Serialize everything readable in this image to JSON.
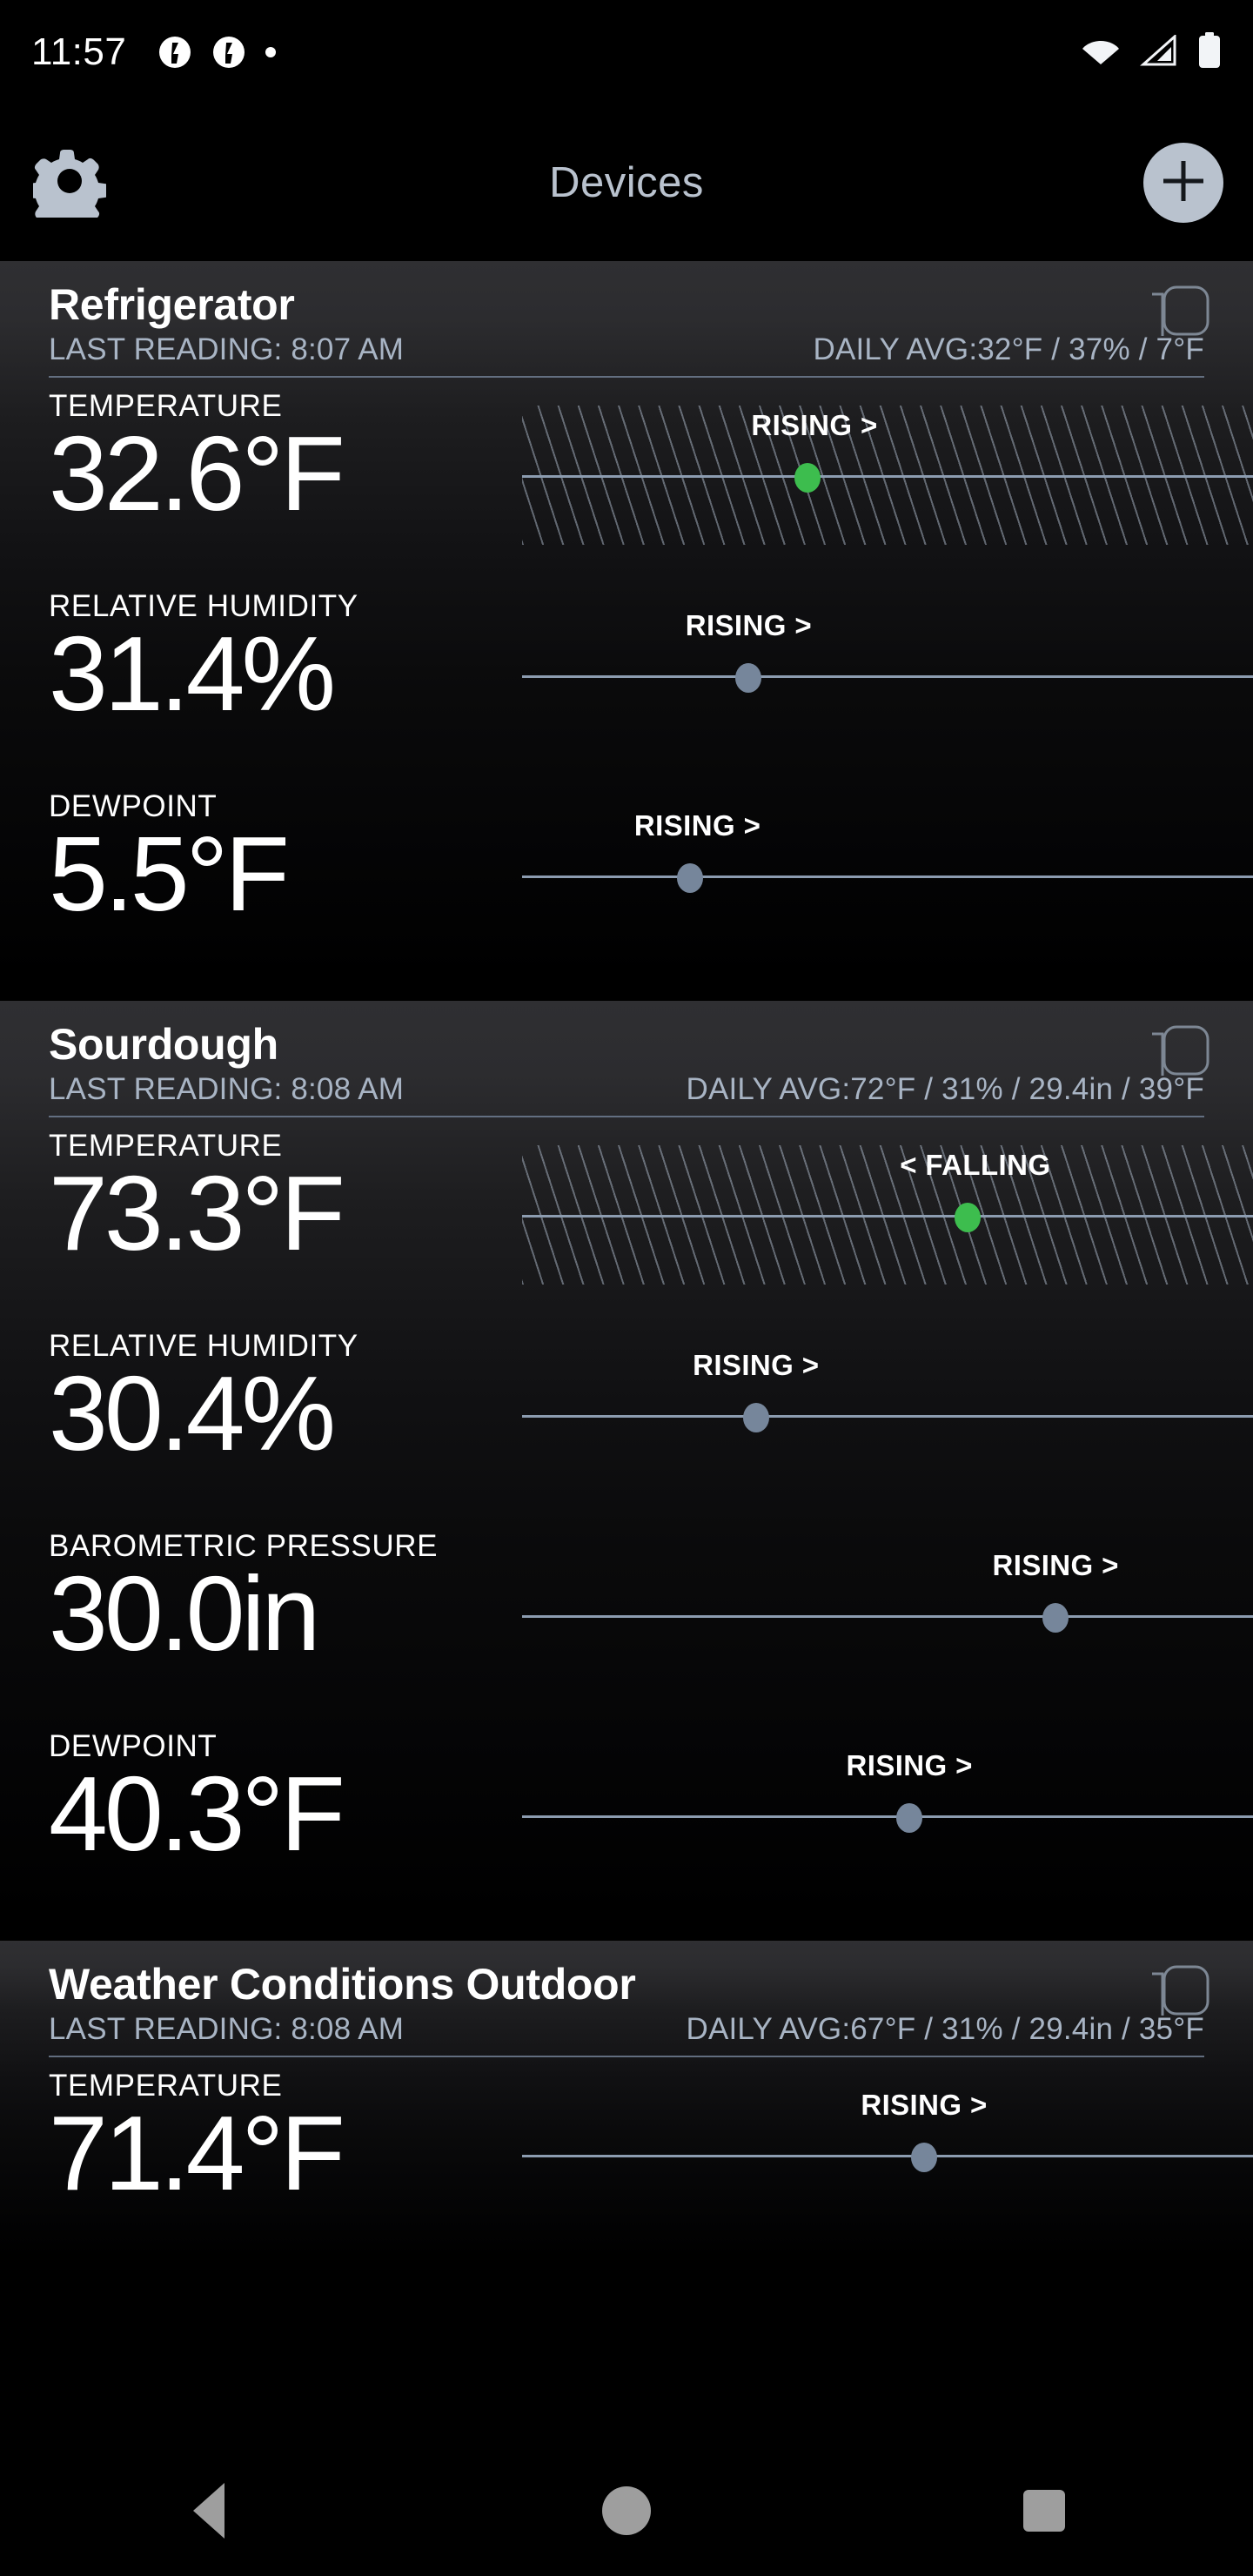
{
  "statusbar": {
    "time": "11:57",
    "icons": [
      "app-notification-icon",
      "app-notification-icon",
      "notification-dot-icon"
    ],
    "right_icons": [
      "wifi-icon",
      "cellular-signal-icon",
      "battery-icon"
    ]
  },
  "header": {
    "settings_icon": "gear-icon",
    "title": "Devices",
    "add_icon": "plus-icon",
    "accent": "#b9c2ce"
  },
  "colors": {
    "background": "#000000",
    "card_top": "#2f2f32",
    "accent": "#b9c2ce",
    "rule": "#6e7d90",
    "dot_alert": "#3dbd4e",
    "dot_normal": "#76869b",
    "sub_text": "#a8b4c4"
  },
  "navbar": {
    "back": "back-triangle-icon",
    "home": "home-circle-icon",
    "recents": "recents-square-icon"
  },
  "devices": [
    {
      "name": "Refrigerator",
      "last_reading": "LAST READING: 8:07 AM",
      "daily_avg": "DAILY AVG:32°F / 37% / 7°F",
      "sensor_icon": "sensor-device-icon",
      "metrics": [
        {
          "label": "TEMPERATURE",
          "value": "32.6°F",
          "trend": "RISING >",
          "dot_color": "alert",
          "hatched": true,
          "dot_pos_pct": 39,
          "trend_pos_pct": 40
        },
        {
          "label": "RELATIVE HUMIDITY",
          "value": "31.4%",
          "trend": "RISING >",
          "dot_color": "normal",
          "hatched": false,
          "dot_pos_pct": 31,
          "trend_pos_pct": 31
        },
        {
          "label": "DEWPOINT",
          "value": "5.5°F",
          "trend": "RISING >",
          "dot_color": "normal",
          "hatched": false,
          "dot_pos_pct": 23,
          "trend_pos_pct": 24
        }
      ]
    },
    {
      "name": "Sourdough",
      "last_reading": "LAST READING: 8:08 AM",
      "daily_avg": "DAILY AVG:72°F / 31% / 29.4in / 39°F",
      "sensor_icon": "sensor-device-icon",
      "metrics": [
        {
          "label": "TEMPERATURE",
          "value": "73.3°F",
          "trend": "< FALLING",
          "dot_color": "alert",
          "hatched": true,
          "dot_pos_pct": 61,
          "trend_pos_pct": 62
        },
        {
          "label": "RELATIVE HUMIDITY",
          "value": "30.4%",
          "trend": "RISING >",
          "dot_color": "normal",
          "hatched": false,
          "dot_pos_pct": 32,
          "trend_pos_pct": 32
        },
        {
          "label": "BAROMETRIC PRESSURE",
          "value": "30.0in",
          "trend": "RISING >",
          "dot_color": "normal",
          "hatched": false,
          "dot_pos_pct": 73,
          "trend_pos_pct": 73
        },
        {
          "label": "DEWPOINT",
          "value": "40.3°F",
          "trend": "RISING >",
          "dot_color": "normal",
          "hatched": false,
          "dot_pos_pct": 53,
          "trend_pos_pct": 53
        }
      ]
    },
    {
      "name": "Weather Conditions Outdoor",
      "last_reading": "LAST READING: 8:08 AM",
      "daily_avg": "DAILY AVG:67°F / 31% / 29.4in / 35°F",
      "sensor_icon": "sensor-device-icon",
      "metrics": [
        {
          "label": "TEMPERATURE",
          "value": "71.4°F",
          "trend": "RISING >",
          "dot_color": "normal",
          "hatched": false,
          "dot_pos_pct": 55,
          "trend_pos_pct": 55
        }
      ]
    }
  ]
}
